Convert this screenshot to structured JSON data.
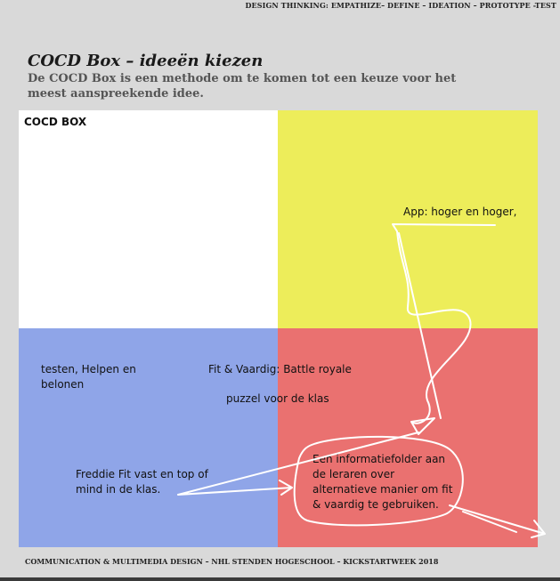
{
  "header": {
    "running_title": "DESIGN THINKING: EMPATHIZE– DEFINE – IDEATION – PROTOTYPE -TEST"
  },
  "page": {
    "title": "COCD Box – ideeën kiezen",
    "subtitle": "De COCD Box is een methode om te komen tot een keuze voor het meest aanspreekende idee."
  },
  "board": {
    "label": "COCD BOX",
    "colors": {
      "top_left": "#ffffff",
      "top_right": "#eded5a",
      "bottom_left": "#8fa5e8",
      "bottom_right": "#ea7170"
    },
    "notes": {
      "app": "App: hoger en hoger,",
      "testen": "testen, Helpen en belonen",
      "fit": "Fit & Vaardig: Battle royale",
      "puzzel": "puzzel voor de klas",
      "freddie": "Freddie Fit vast en top of mind in de klas.",
      "folder": "Een informatiefolder aan de leraren over alternatieve manier om fit & vaardig te gebruiken."
    }
  },
  "footer": {
    "text": "COMMUNICATION & MULTIMEDIA DESIGN – NHL  STENDEN HOGESCHOOL – KICKSTARTWEEK 2018"
  }
}
